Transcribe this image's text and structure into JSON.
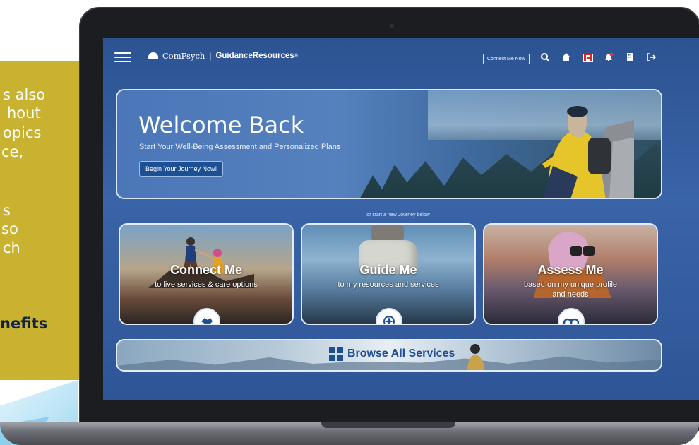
{
  "promo": {
    "lines": [
      "s also",
      "hout",
      "opics",
      "ce,",
      "",
      "s",
      "so",
      "ch",
      "",
      "nefits"
    ]
  },
  "header": {
    "brand_name": "ComPsych",
    "brand_separator": "|",
    "brand_app": "GuidanceResources",
    "brand_trademark": "®",
    "connect_now_label": "Connect Me Now",
    "icons": [
      "menu-icon",
      "search-icon",
      "home-icon",
      "canada-flag-icon",
      "bell-icon",
      "building-icon",
      "logout-icon"
    ]
  },
  "hero": {
    "title": "Welcome Back",
    "subtitle": "Start Your Well-Being Assessment and Personalized Plans",
    "button_label": "Begin Your Journey Now!"
  },
  "divider_text": "or start a new Journey below",
  "cards": [
    {
      "title": "Connect Me",
      "subtitle": "to live services & care options",
      "icon": "handshake-icon"
    },
    {
      "title": "Guide Me",
      "subtitle": "to my resources and services",
      "icon": "compass-icon"
    },
    {
      "title": "Assess Me",
      "subtitle": "based on my unique profile and needs",
      "icon": "binoculars-icon"
    }
  ],
  "browse": {
    "label": "Browse All Services",
    "icon": "grid-icon"
  },
  "colors": {
    "accent": "#1d4f93",
    "screen_bg": "#2c5392",
    "promo_bg": "#c9b22f"
  }
}
